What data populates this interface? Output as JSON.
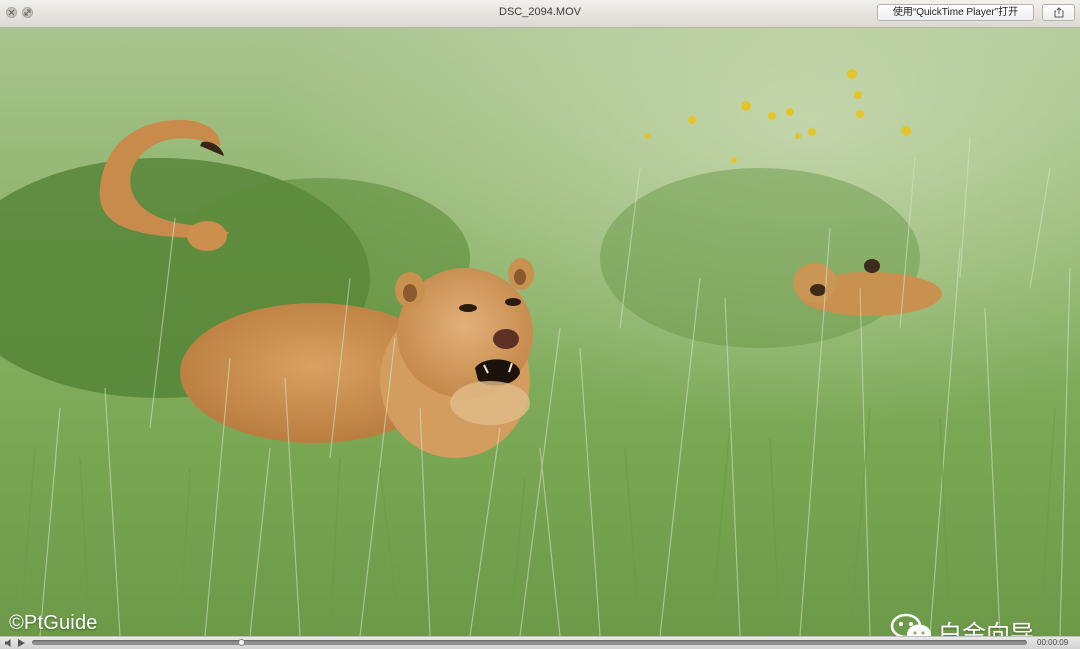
{
  "window": {
    "title": "DSC_2094.MOV",
    "open_with_label": "使用“QuickTime Player”打开",
    "icons": [
      "close-icon",
      "minimize-icon",
      "share-icon"
    ]
  },
  "video": {
    "watermark_left": "©PtGuide",
    "watermark_right": "白金向导",
    "watermark_icon": "wechat-icon"
  },
  "controls": {
    "timecode": "00:00:09",
    "progress": 0.21,
    "icons": [
      "volume-icon",
      "play-icon"
    ]
  },
  "colors": {
    "grass": "#7fae5c",
    "lion": "#c98f4f",
    "chrome": "#e4e1dc"
  }
}
